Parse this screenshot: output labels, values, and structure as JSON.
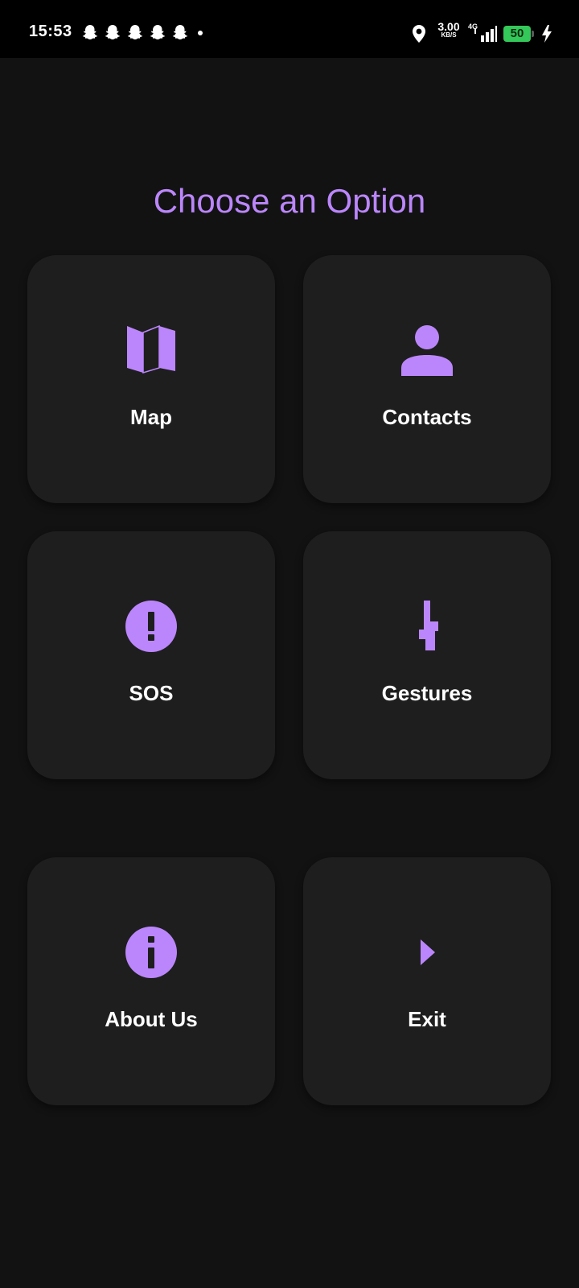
{
  "status_bar": {
    "time": "15:53",
    "net_speed_value": "3.00",
    "net_speed_unit": "KB/S",
    "network_type": "4G",
    "battery": "50"
  },
  "title": "Choose an Option",
  "colors": {
    "accent": "#bb86fc",
    "background": "#121212",
    "card": "#1e1e1e",
    "battery": "#34c759"
  },
  "options": [
    {
      "label": "Map",
      "icon": "map-icon"
    },
    {
      "label": "Contacts",
      "icon": "person-icon"
    },
    {
      "label": "SOS",
      "icon": "alert-icon"
    },
    {
      "label": "Gestures",
      "icon": "gesture-icon"
    },
    {
      "label": "About Us",
      "icon": "info-icon"
    },
    {
      "label": "Exit",
      "icon": "arrow-right-icon"
    }
  ]
}
